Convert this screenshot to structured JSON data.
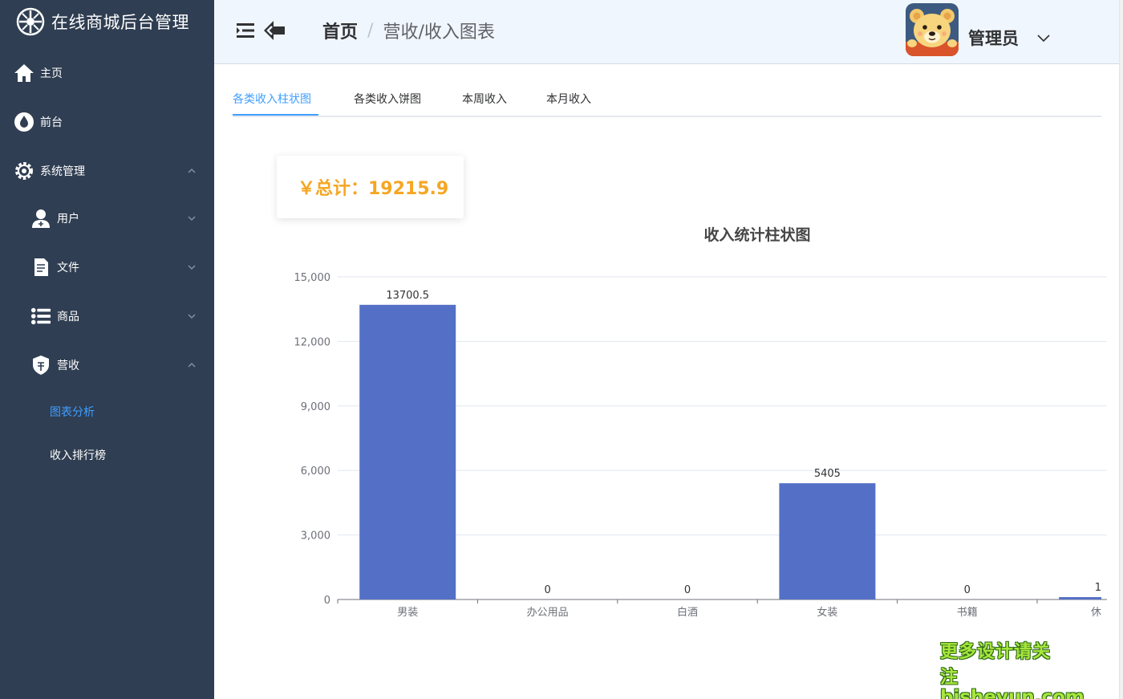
{
  "app": {
    "title": "在线商城后台管理"
  },
  "sidebar": {
    "items": [
      {
        "label": "主页",
        "icon": "home-icon"
      },
      {
        "label": "前台",
        "icon": "water-drop-icon"
      },
      {
        "label": "系统管理",
        "icon": "settings-gear-icon",
        "expanded": true
      },
      {
        "label": "用户",
        "icon": "user-icon",
        "expanded": false
      },
      {
        "label": "文件",
        "icon": "document-icon",
        "expanded": false
      },
      {
        "label": "商品",
        "icon": "list-icon",
        "expanded": false
      },
      {
        "label": "营收",
        "icon": "shield-icon",
        "expanded": true
      }
    ],
    "sub_items": [
      {
        "label": "图表分析",
        "active": true
      },
      {
        "label": "收入排行榜",
        "active": false
      }
    ],
    "colors": {
      "background": "#2f3e52",
      "active_text": "#409eff"
    }
  },
  "header": {
    "breadcrumb_home": "首页",
    "breadcrumb_separator": "/",
    "breadcrumb_current": "营收/收入图表",
    "user_name": "管理员"
  },
  "tabs": [
    {
      "label": "各类收入柱状图",
      "active": true
    },
    {
      "label": "各类收入饼图",
      "active": false
    },
    {
      "label": "本周收入",
      "active": false
    },
    {
      "label": "本月收入",
      "active": false
    }
  ],
  "summary": {
    "total_text": "￥总计：19215.9"
  },
  "chart_data": {
    "type": "bar",
    "title": "收入统计柱状图",
    "categories": [
      "男装",
      "办公用品",
      "白酒",
      "女装",
      "书籍",
      "休"
    ],
    "values": [
      13700.5,
      0,
      0,
      5405,
      0,
      110.4
    ],
    "value_labels": [
      "13700.5",
      "0",
      "0",
      "5405",
      "0",
      "1"
    ],
    "ylim": [
      0,
      15000
    ],
    "yticks": [
      0,
      3000,
      6000,
      9000,
      12000,
      15000
    ],
    "ytick_labels": [
      "0",
      "3,000",
      "6,000",
      "9,000",
      "12,000",
      "15,000"
    ],
    "grid": true,
    "bar_color": "#5470c6"
  },
  "watermark": {
    "line1": "更多设计请关注",
    "line2": "bisheyun.com"
  }
}
